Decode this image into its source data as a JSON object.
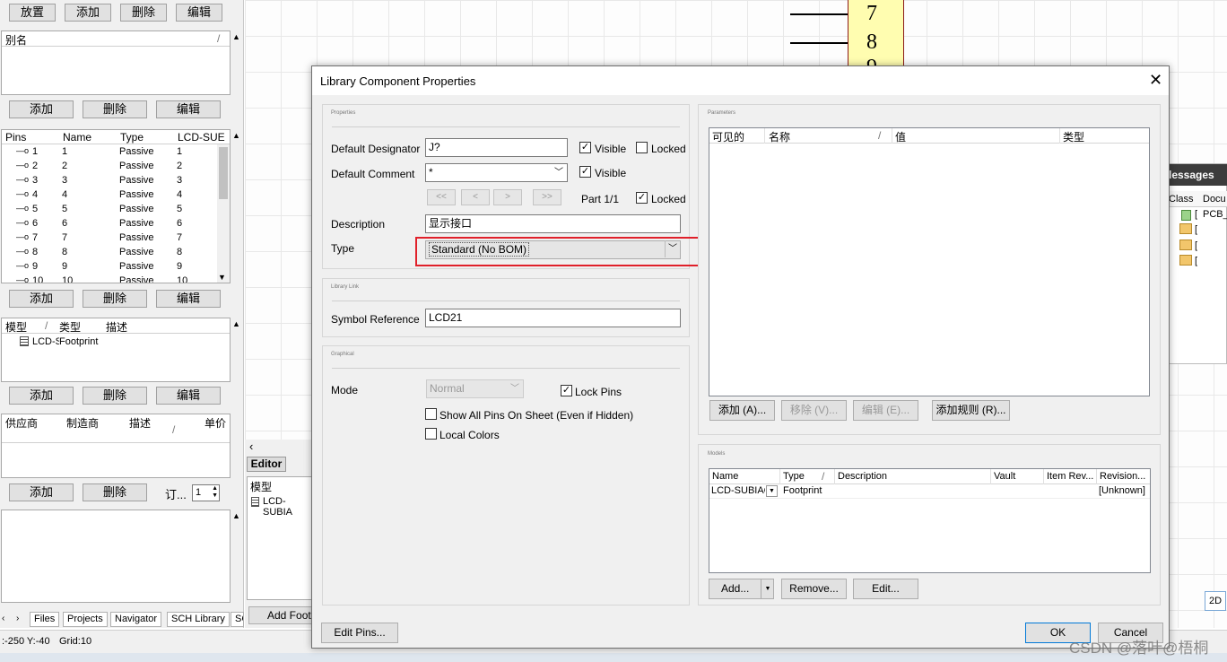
{
  "left_panel": {
    "top_buttons": [
      "放置",
      "添加",
      "删除",
      "编辑"
    ],
    "alias_header": "别名",
    "alias_buttons": [
      "添加",
      "删除",
      "编辑"
    ],
    "pins_columns": [
      "Pins",
      "Name",
      "Type",
      "LCD-SUE"
    ],
    "pins": [
      {
        "pin": "1",
        "name": "1",
        "type": "Passive",
        "lcd": "1"
      },
      {
        "pin": "2",
        "name": "2",
        "type": "Passive",
        "lcd": "2"
      },
      {
        "pin": "3",
        "name": "3",
        "type": "Passive",
        "lcd": "3"
      },
      {
        "pin": "4",
        "name": "4",
        "type": "Passive",
        "lcd": "4"
      },
      {
        "pin": "5",
        "name": "5",
        "type": "Passive",
        "lcd": "5"
      },
      {
        "pin": "6",
        "name": "6",
        "type": "Passive",
        "lcd": "6"
      },
      {
        "pin": "7",
        "name": "7",
        "type": "Passive",
        "lcd": "7"
      },
      {
        "pin": "8",
        "name": "8",
        "type": "Passive",
        "lcd": "8"
      },
      {
        "pin": "9",
        "name": "9",
        "type": "Passive",
        "lcd": "9"
      },
      {
        "pin": "10",
        "name": "10",
        "type": "Passive",
        "lcd": "10"
      }
    ],
    "pins_buttons": [
      "添加",
      "删除",
      "编辑"
    ],
    "model_columns": [
      "模型",
      "类型",
      "描述"
    ],
    "model_row": {
      "model": "LCD-S",
      "type": "Footprint"
    },
    "model_buttons": [
      "添加",
      "删除",
      "编辑"
    ],
    "supplier_columns": [
      "供应商",
      "制造商",
      "描述",
      "单价"
    ],
    "supplier_buttons": [
      "添加",
      "删除"
    ],
    "order_label": "订...",
    "order_value": "1",
    "bottom_tabs": [
      "Files",
      "Projects",
      "Navigator",
      "SCH Library",
      "SC"
    ]
  },
  "status_bar": {
    "coords": ":-250 Y:-40",
    "grid": "Grid:10"
  },
  "schematic": {
    "pin_numbers": [
      "7",
      "8",
      "9"
    ]
  },
  "editor_panel": {
    "tab": "Editor",
    "model_header": "模型",
    "model_row": "LCD-SUBIA",
    "add_footprint": "Add Footp"
  },
  "messages_panel": {
    "title": "lessages",
    "columns": [
      "Class",
      "Docu"
    ],
    "rows": [
      "[",
      "[",
      "[",
      "["
    ],
    "first_doc": "PCB_F",
    "view_2d": "2D"
  },
  "dialog": {
    "title": "Library Component Properties",
    "properties_group": "Properties",
    "default_designator_label": "Default Designator",
    "default_designator_value": "J?",
    "visible_label": "Visible",
    "locked_label": "Locked",
    "default_comment_label": "Default Comment",
    "default_comment_value": "*",
    "nav_buttons": [
      "<<",
      "<",
      ">",
      ">>"
    ],
    "part_label": "Part 1/1",
    "description_label": "Description",
    "description_value": "显示接口",
    "type_label": "Type",
    "type_value": "Standard (No BOM)",
    "library_link_group": "Library Link",
    "symbol_reference_label": "Symbol Reference",
    "symbol_reference_value": "LCD21",
    "graphical_group": "Graphical",
    "mode_label": "Mode",
    "mode_value": "Normal",
    "lock_pins_label": "Lock Pins",
    "show_all_pins_label": "Show All Pins On Sheet (Even if Hidden)",
    "local_colors_label": "Local Colors",
    "parameters_group": "Parameters",
    "param_columns": [
      "可见的",
      "名称",
      "值",
      "类型"
    ],
    "param_buttons": [
      "添加 (A)...",
      "移除 (V)...",
      "编辑 (E)...",
      "添加规则 (R)..."
    ],
    "models_group": "Models",
    "model_columns": [
      "Name",
      "Type",
      "Description",
      "Vault",
      "Item Rev...",
      "Revision..."
    ],
    "model_row": {
      "name": "LCD-SUBIAC",
      "type": "Footprint",
      "description": "",
      "vault": "",
      "item_rev": "",
      "revision": "[Unknown]"
    },
    "model_buttons": [
      "Add...",
      "Remove...",
      "Edit..."
    ],
    "edit_pins": "Edit Pins...",
    "ok": "OK",
    "cancel": "Cancel",
    "highlight_color": "#e0202a"
  },
  "watermark": "CSDN @落叶@梧桐"
}
